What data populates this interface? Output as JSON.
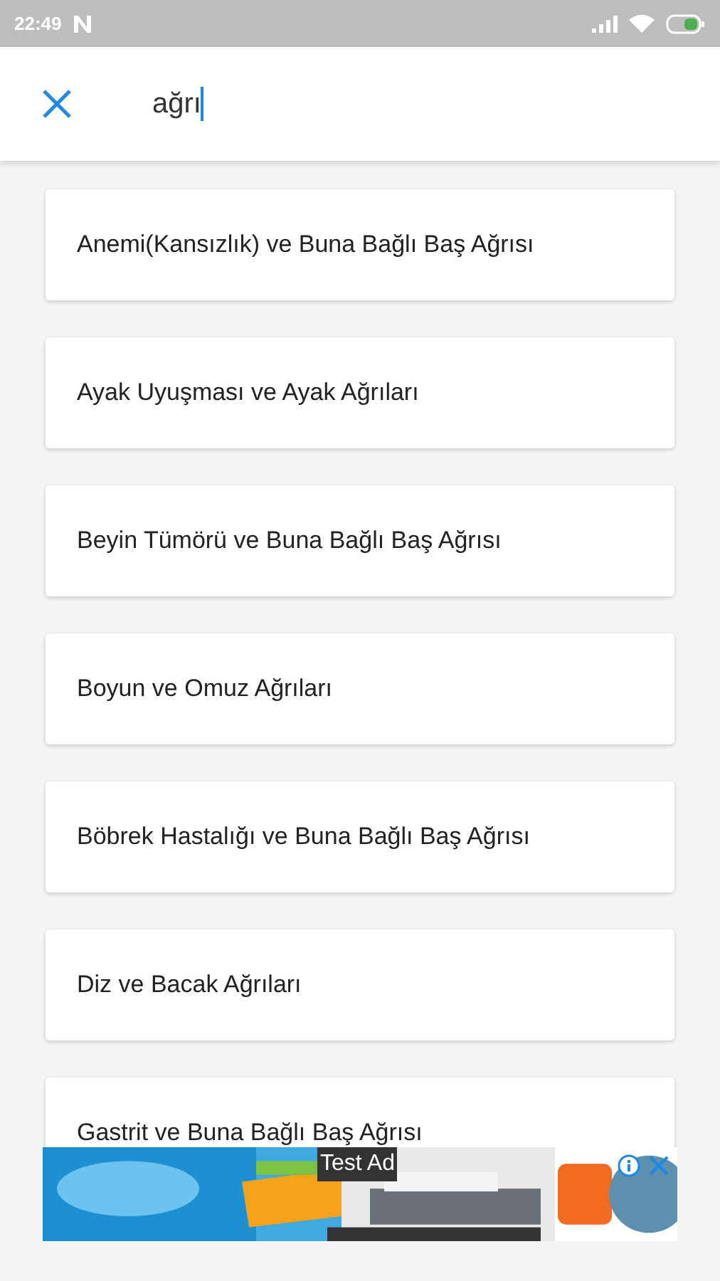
{
  "status_bar": {
    "time": "22:49"
  },
  "search": {
    "value": "ağrı"
  },
  "results": [
    {
      "label": "Anemi(Kansızlık) ve Buna Bağlı Baş Ağrısı"
    },
    {
      "label": "Ayak Uyuşması ve Ayak Ağrıları"
    },
    {
      "label": "Beyin Tümörü ve Buna Bağlı Baş Ağrısı"
    },
    {
      "label": "Boyun ve Omuz Ağrıları"
    },
    {
      "label": "Böbrek Hastalığı ve Buna Bağlı Baş Ağrısı"
    },
    {
      "label": "Diz ve Bacak Ağrıları"
    },
    {
      "label": "Gastrit ve Buna Bağlı Baş Ağrısı"
    }
  ],
  "ad": {
    "kind": "picture",
    "label": "Test Ad"
  }
}
